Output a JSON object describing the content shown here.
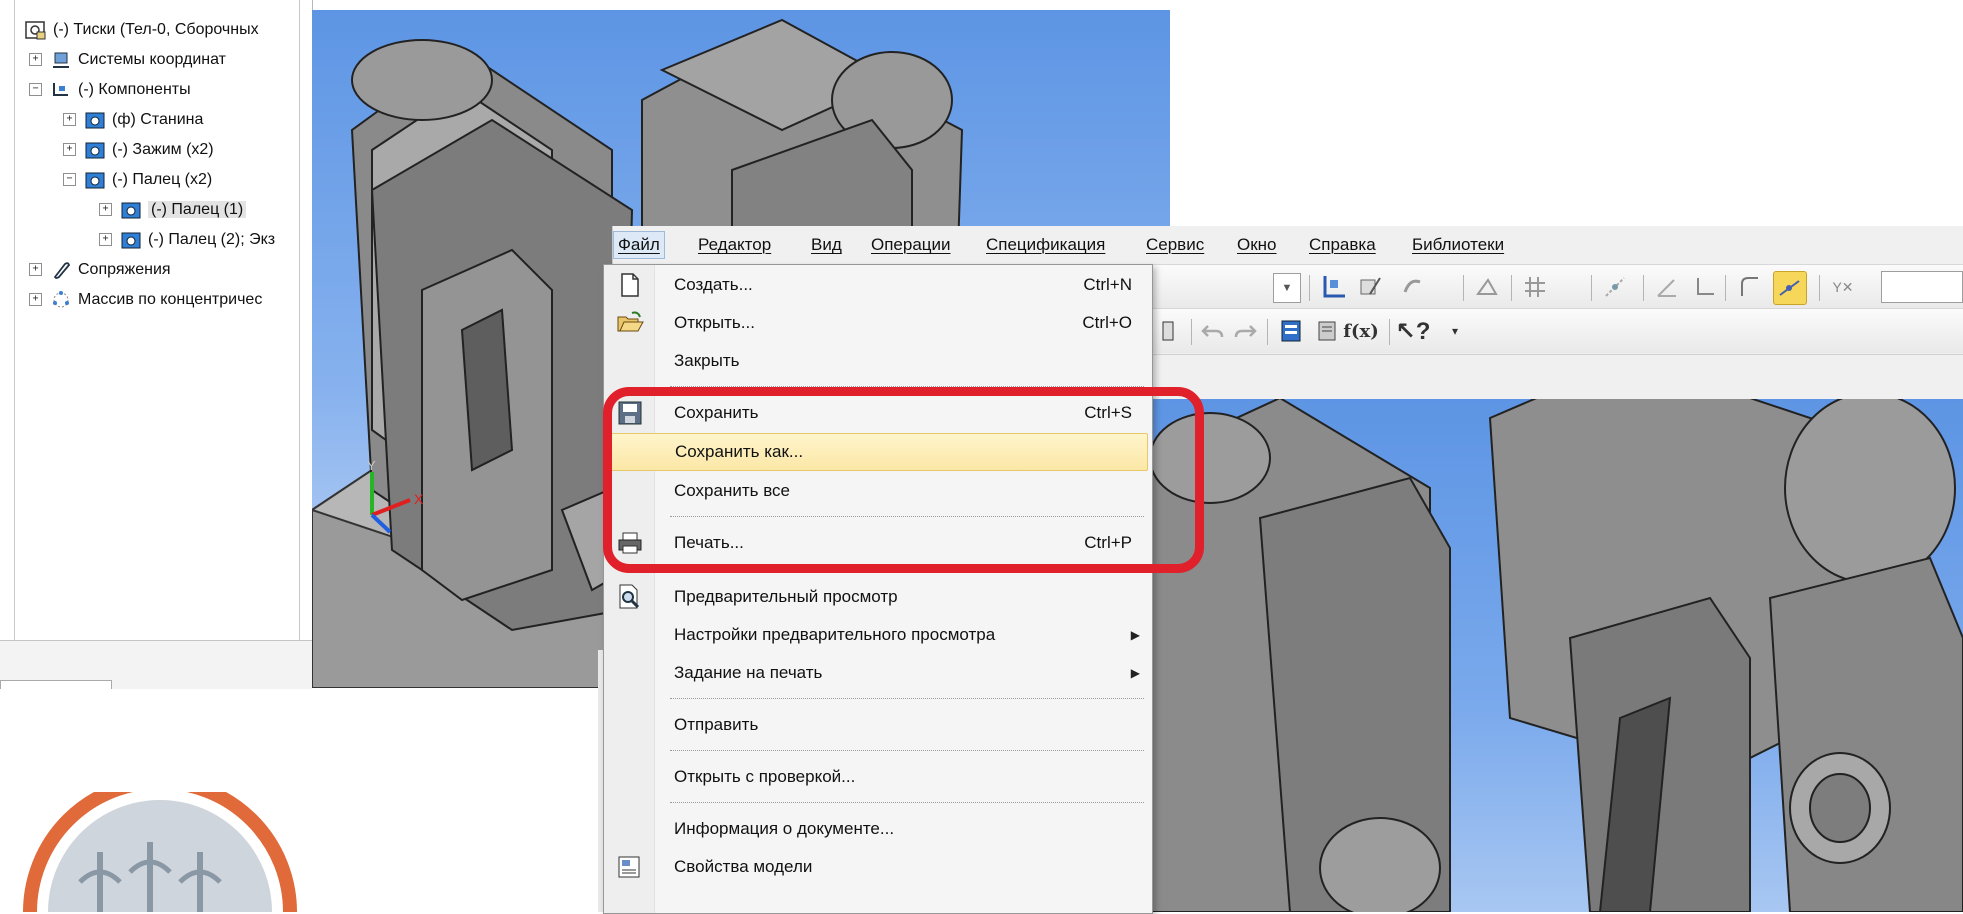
{
  "tree": {
    "items": [
      {
        "label": "(-) Тиски (Тел-0, Сборочных",
        "toggle": "",
        "icon": "assembly-icon"
      },
      {
        "label": "Системы координат",
        "toggle": "+",
        "icon": "coordinate-systems-icon"
      },
      {
        "label": "(-) Компоненты",
        "toggle": "−",
        "icon": "components-icon"
      },
      {
        "label": "(ф) Станина",
        "toggle": "+",
        "icon": "part-icon"
      },
      {
        "label": "(-) Зажим (x2)",
        "toggle": "+",
        "icon": "part-icon"
      },
      {
        "label": "(-) Палец (x2)",
        "toggle": "−",
        "icon": "part-icon"
      },
      {
        "label": "(-) Палец (1)",
        "toggle": "+",
        "icon": "part-icon"
      },
      {
        "label": "(-) Палец (2); Экз",
        "toggle": "+",
        "icon": "part-icon"
      },
      {
        "label": "Сопряжения",
        "toggle": "+",
        "icon": "mates-icon"
      },
      {
        "label": "Массив по концентричес",
        "toggle": "+",
        "icon": "pattern-icon"
      }
    ]
  },
  "axes": {
    "x": "X",
    "y": "Y"
  },
  "menubar": {
    "items": [
      {
        "label": "Файл"
      },
      {
        "label": "Редактор"
      },
      {
        "label": "Вид"
      },
      {
        "label": "Операции"
      },
      {
        "label": "Спецификация"
      },
      {
        "label": "Сервис"
      },
      {
        "label": "Окно"
      },
      {
        "label": "Справка"
      },
      {
        "label": "Библиотеки"
      }
    ]
  },
  "file_menu": {
    "items": [
      {
        "label": "Создать...",
        "shortcut": "Ctrl+N",
        "icon": "new-document-icon"
      },
      {
        "label": "Открыть...",
        "shortcut": "Ctrl+O",
        "icon": "open-folder-icon"
      },
      {
        "label": "Закрыть",
        "shortcut": "",
        "icon": ""
      },
      {
        "label": "Сохранить",
        "shortcut": "Ctrl+S",
        "icon": "save-icon"
      },
      {
        "label": "Сохранить как...",
        "shortcut": "",
        "icon": ""
      },
      {
        "label": "Сохранить все",
        "shortcut": "",
        "icon": ""
      },
      {
        "label": "Печать...",
        "shortcut": "Ctrl+P",
        "icon": "print-icon"
      },
      {
        "label": "Предварительный просмотр",
        "shortcut": "",
        "icon": "print-preview-icon"
      },
      {
        "label": "Настройки предварительного просмотра",
        "shortcut": "",
        "icon": ""
      },
      {
        "label": "Задание на печать",
        "shortcut": "",
        "icon": ""
      },
      {
        "label": "Отправить",
        "shortcut": "",
        "icon": ""
      },
      {
        "label": "Открыть с проверкой...",
        "shortcut": "",
        "icon": ""
      },
      {
        "label": "Информация о документе...",
        "shortcut": "",
        "icon": ""
      },
      {
        "label": "Свойства модели",
        "shortcut": "",
        "icon": "model-properties-icon"
      }
    ]
  },
  "colors": {
    "highlight_frame": "#e0202a",
    "hover_item": "#fbe7a6",
    "viewport_sky": "#5d95e4",
    "model_gray": "#8a8a8a"
  }
}
